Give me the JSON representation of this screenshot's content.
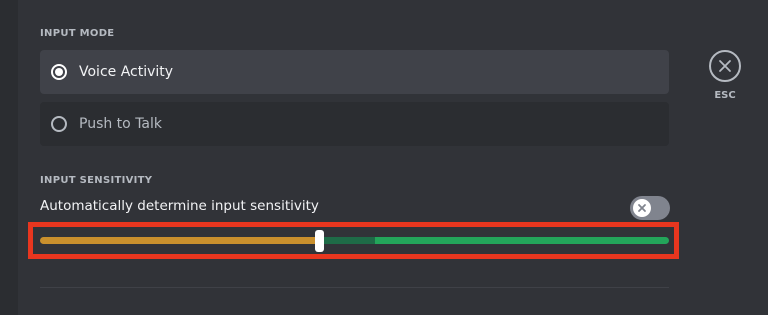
{
  "input_mode": {
    "title": "INPUT MODE",
    "options": [
      {
        "label": "Voice Activity",
        "selected": true
      },
      {
        "label": "Push to Talk",
        "selected": false
      }
    ]
  },
  "esc": {
    "label": "ESC",
    "icon": "close-icon"
  },
  "input_sensitivity": {
    "title": "INPUT SENSITIVITY",
    "auto_label": "Automatically determine input sensitivity",
    "auto_enabled": false,
    "slider_value_fraction": 0.5,
    "level_fraction": 0.53
  },
  "colors": {
    "background": "#313338",
    "selected_option": "#404249",
    "option": "#2b2d31",
    "slider_low": "#c9902d",
    "slider_high": "#23a55a",
    "highlight": "#e8361f"
  }
}
